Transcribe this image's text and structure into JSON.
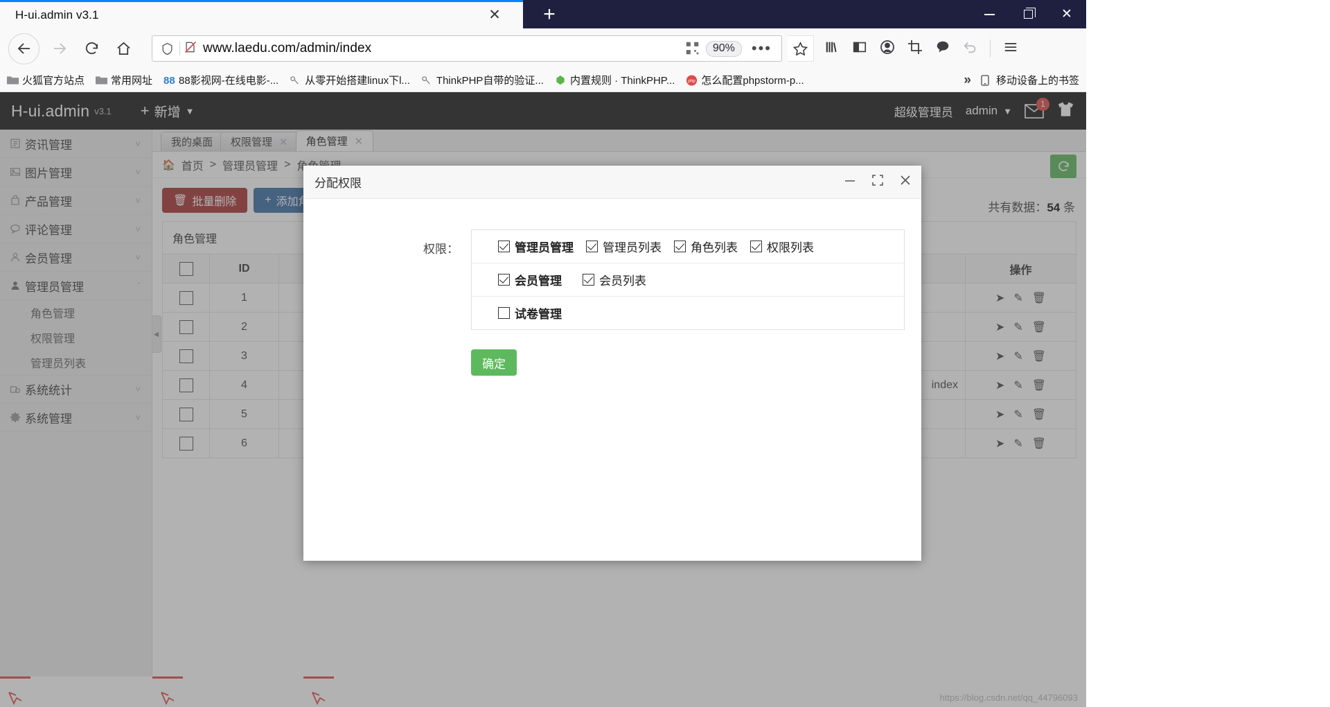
{
  "browser": {
    "tab_title": "H-ui.admin v3.1",
    "tab_close": "✕",
    "new_tab": "+",
    "url": "www.laedu.com/admin/index",
    "zoom": "90%",
    "ellipsis": "•••",
    "bookmarks": [
      {
        "label": "火狐官方站点",
        "icon": "folder-icon"
      },
      {
        "label": "常用网址",
        "icon": "folder-icon"
      },
      {
        "label": "88影视网-在线电影-...",
        "icon": "88-icon"
      },
      {
        "label": "从零开始搭建linux下l...",
        "icon": "page-icon"
      },
      {
        "label": "ThinkPHP自带的验证...",
        "icon": "page-icon"
      },
      {
        "label": "内置规则 · ThinkPHP...",
        "icon": "thinkphp-icon"
      },
      {
        "label": "怎么配置phpstorm-p...",
        "icon": "php-icon"
      }
    ],
    "bookmarks_overflow": "»",
    "mobile_bookmarks": "移动设备上的书签"
  },
  "app_header": {
    "logo": "H-ui.admin",
    "version": "v3.1",
    "add_new": "新增",
    "role_name": "超级管理员",
    "user_name": "admin",
    "mail_badge": "1"
  },
  "sidebar": {
    "items": [
      {
        "label": "资讯管理",
        "icon": "news-icon",
        "expanded": false
      },
      {
        "label": "图片管理",
        "icon": "image-icon",
        "expanded": false
      },
      {
        "label": "产品管理",
        "icon": "bag-icon",
        "expanded": false
      },
      {
        "label": "评论管理",
        "icon": "comment-icon",
        "expanded": false
      },
      {
        "label": "会员管理",
        "icon": "user-outline-icon",
        "expanded": false
      },
      {
        "label": "管理员管理",
        "icon": "user-solid-icon",
        "expanded": true
      }
    ],
    "sub_items": [
      {
        "label": "角色管理"
      },
      {
        "label": "权限管理"
      },
      {
        "label": "管理员列表"
      }
    ],
    "items_after": [
      {
        "label": "系统统计",
        "icon": "stats-icon",
        "expanded": false
      },
      {
        "label": "系统管理",
        "icon": "gear-icon",
        "expanded": false
      }
    ]
  },
  "content_tabs": [
    {
      "label": "我的桌面",
      "closable": false,
      "active": false
    },
    {
      "label": "权限管理",
      "closable": true,
      "active": false
    },
    {
      "label": "角色管理",
      "closable": true,
      "active": true
    }
  ],
  "breadcrumb": [
    "首页",
    "管理员管理",
    "角色管理"
  ],
  "breadcrumb_sep": ">",
  "toolbar": {
    "batch_delete": "批量删除",
    "add_role": "添加角色",
    "total_label": "共有数据：",
    "total_count": "54",
    "total_unit": "条"
  },
  "table": {
    "caption": "角色管理",
    "columns": [
      "",
      "ID",
      "操作"
    ],
    "rows": [
      {
        "id": "1",
        "extra": ""
      },
      {
        "id": "2",
        "extra": ""
      },
      {
        "id": "3",
        "extra": ""
      },
      {
        "id": "4",
        "extra": "index"
      },
      {
        "id": "5",
        "extra": ""
      },
      {
        "id": "6",
        "extra": ""
      }
    ]
  },
  "modal": {
    "title": "分配权限",
    "minimize": "─",
    "maximize": "⛶",
    "close": "✕",
    "field_label": "权限：",
    "confirm": "确定",
    "permission_groups": [
      {
        "parent": {
          "label": "管理员管理",
          "checked": true
        },
        "children": [
          {
            "label": "管理员列表",
            "checked": true
          },
          {
            "label": "角色列表",
            "checked": true
          },
          {
            "label": "权限列表",
            "checked": true
          }
        ]
      },
      {
        "parent": {
          "label": "会员管理",
          "checked": true
        },
        "children": [
          {
            "label": "会员列表",
            "checked": true
          }
        ]
      },
      {
        "parent": {
          "label": "试卷管理",
          "checked": false
        },
        "children": []
      }
    ]
  },
  "watermark": "https://blog.csdn.net/qq_44796093",
  "colors": {
    "titlebar": "#1f2040",
    "accent": "#0a84ff",
    "app_header": "#1b1b1b",
    "danger": "#aa3333",
    "primary": "#3a6ea5",
    "success": "#5eb95e",
    "badge": "#e04a48"
  }
}
